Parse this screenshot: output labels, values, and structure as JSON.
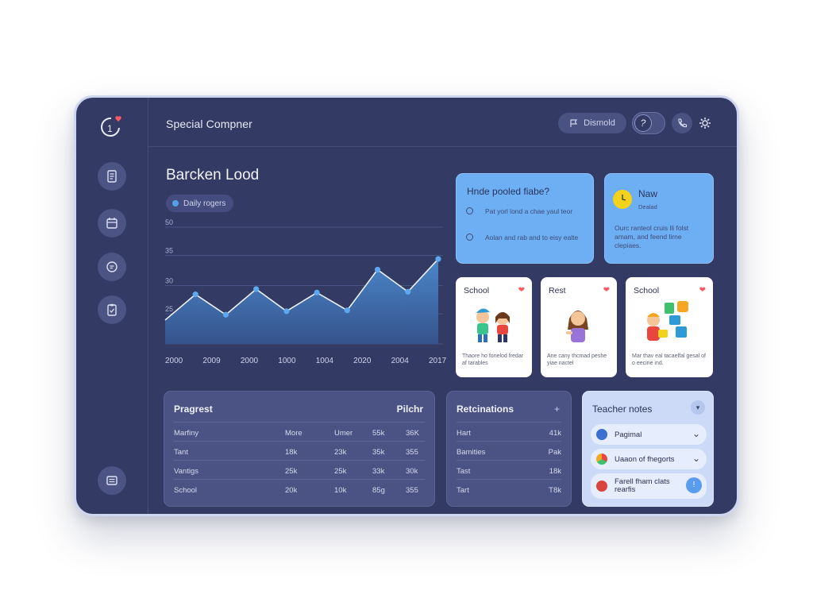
{
  "app": {
    "title": "Special Compner",
    "logo_text": "1"
  },
  "topbar": {
    "pill_label": "Dismold",
    "toggle_glyph": "?",
    "icons": [
      "phone-icon",
      "gear-icon"
    ]
  },
  "sidebar": {
    "items": [
      "document-icon",
      "calendar-icon",
      "chat-icon",
      "clipboard-icon"
    ],
    "bottom_item": "menu-icon"
  },
  "chart": {
    "title": "Barcken Lood",
    "legend_label": "Daily rogers"
  },
  "chart_data": {
    "type": "area",
    "title": "Barcken Lood",
    "series": [
      {
        "name": "Daily rogers",
        "values": [
          13.5,
          28,
          16.5,
          31,
          18.5,
          29,
          19,
          42,
          29.5,
          48
        ]
      }
    ],
    "x_tick_labels": [
      "2000",
      "2009",
      "2000",
      "1000",
      "1004",
      "2020",
      "2004",
      "2017"
    ],
    "y_tick_labels": [
      "10",
      "25",
      "30",
      "35",
      "50"
    ],
    "y_tick_values": [
      0,
      17,
      33,
      50,
      66
    ],
    "ylim": [
      0,
      66
    ],
    "grid": true,
    "color": "#4f8fd6"
  },
  "cards_top": [
    {
      "title": "Hnde pooled fiabe?",
      "items": [
        "Pat yorl lond a chae yaul teor",
        "Aolan and rab and to eisy ealte"
      ]
    },
    {
      "title": "Naw",
      "subtitle": "Dealad",
      "text": "Ourc ranteol cruis lli folst amam, and feend lirne clepiaes."
    }
  ],
  "cards_school": [
    {
      "label": "School",
      "desc": "Thaore ho fonelod fredar af tarables"
    },
    {
      "label": "Rest",
      "desc": "Ane cany thcmad peshe yiae nactel"
    },
    {
      "label": "School",
      "desc": "Mar thav eal tacaelfal gesal of o eecine ind."
    }
  ],
  "progress": {
    "title": "Pragrest",
    "right_label": "Pilchr",
    "columns": [
      "Marfiny",
      "More",
      "Umer",
      "55k",
      "36K"
    ],
    "rows": [
      [
        "Tant",
        "18k",
        "23k",
        "35k",
        "355"
      ],
      [
        "Vantigs",
        "25k",
        "25k",
        "33k",
        "30k"
      ],
      [
        "School",
        "20k",
        "10k",
        "85g",
        "355"
      ]
    ]
  },
  "relations": {
    "title": "Retcinations",
    "action_glyph": "+",
    "rows": [
      [
        "Hart",
        "41k"
      ],
      [
        "Bamities",
        "Pak"
      ],
      [
        "Tast",
        "18k"
      ],
      [
        "Tart",
        "T8k"
      ]
    ]
  },
  "teacher_notes": {
    "title": "Teacher notes",
    "items": [
      {
        "label": "Pagimal",
        "color": "#3b6fd1"
      },
      {
        "label": "Uaaon of fhegorts",
        "color": "#e8833a"
      },
      {
        "label": "Farell fham clats rearfis",
        "color": "#d9443c"
      }
    ],
    "fab_glyph": "!"
  },
  "colors": {
    "background": "#333a64",
    "accent": "#4fa2ea",
    "card_blue": "#6eaef3",
    "heart": "#ff5a60"
  }
}
